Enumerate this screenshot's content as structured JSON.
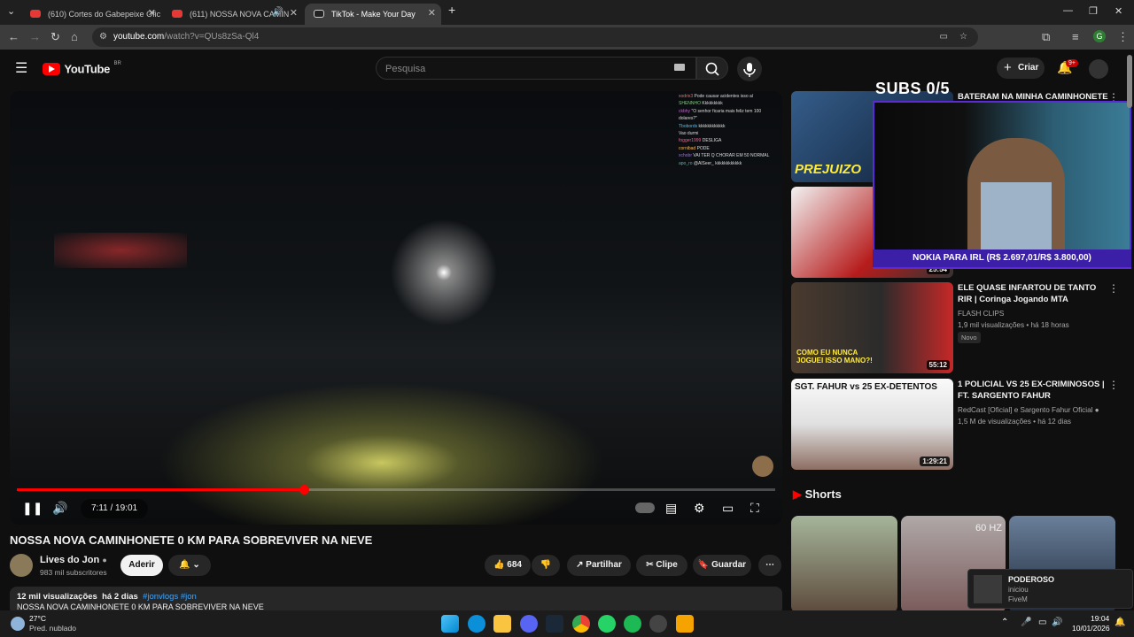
{
  "browser": {
    "tabs": [
      {
        "label": "(610) Cortes do Gabepeixe Ofic",
        "active": false
      },
      {
        "label": "(611) NOSSA NOVA CAMIN",
        "active": false
      },
      {
        "label": "TikTok - Make Your Day",
        "active": true
      }
    ],
    "url_host": "youtube.com",
    "url_path": "/watch?v=QUs8zSa-Ql4",
    "new_tab": "+",
    "profile_initial": "G"
  },
  "header": {
    "logo": "YouTube",
    "region": "BR",
    "search_placeholder": "Pesquisa",
    "create_label": "Criar",
    "notifications": "9+"
  },
  "video": {
    "current_time": "7:11",
    "duration": "19:01",
    "time_text": "7:11 / 19:01",
    "progress": 0.378,
    "chat": [
      {
        "user": "xodrix3",
        "text": "Pode causar acidentes isso aí"
      },
      {
        "user": "SHENNHO",
        "text": "Kkkkkkkkk"
      },
      {
        "user": "ckbhy",
        "text": "\"O senhor ficaria mais feliz tem 100 dolares?\""
      },
      {
        "user": "Tbobords",
        "text": "kkkkkkkkkkkk"
      },
      {
        "user": "",
        "text": "Vao durmi"
      },
      {
        "user": "fogger1999",
        "text": "DESLIGA"
      },
      {
        "user": "cornibad",
        "text": "PODE"
      },
      {
        "user": "xchobr",
        "text": "VAI TER Q CHORAR EM 50 NORMAL"
      },
      {
        "user": "apo_ro",
        "text": "@AlSeer_ kkkkkkkkkkkk"
      }
    ]
  },
  "meta": {
    "title": "NOSSA NOVA CAMINHONETE 0 KM PARA SOBREVIVER NA NEVE",
    "channel": "Lives do Jon",
    "subscribers": "983 mil subscritores",
    "join_label": "Aderir",
    "likes": "684",
    "share_label": "Partilhar",
    "clip_label": "Clipe",
    "save_label": "Guardar",
    "views": "12 mil visualizações",
    "age": "há 2 dias",
    "tags": "#jonvlogs #jon",
    "desc_preview": "NOSSA NOVA CAMINHONETE 0 KM PARA SOBREVIVER NA NEVE"
  },
  "overlay": {
    "subs_counter": "SUBS 0/5",
    "cam_caption": "NOKIA PARA IRL (R$ 2.697,01/R$ 3.800,00)"
  },
  "recommendations": [
    {
      "title": "BATERAM NA MINHA CAMINHONETE",
      "thumb_text": "PREJUIZO",
      "duration": "",
      "channel": "",
      "stats": ""
    },
    {
      "title": "",
      "thumb_text": "",
      "duration": "25:54",
      "channel": "",
      "stats": ""
    },
    {
      "title": "ELE QUASE INFARTOU DE TANTO RIR | Coringa Jogando MTA",
      "thumb_text": "COMO EU NUNCA JOGUEI ISSO MANO?!",
      "duration": "55:12",
      "channel": "FLASH CLIPS",
      "stats": "1,9 mil visualizações • há 18 horas",
      "badge": "Novo"
    },
    {
      "title": "1 POLICIAL VS 25 EX-CRIMINOSOS | FT. SARGENTO FAHUR",
      "thumb_text": "SGT. FAHUR vs 25 EX-DETENTOS",
      "duration": "1:29:21",
      "channel": "RedCast [Oficial] e Sargento Fahur Oficial",
      "stats": "1,5 M de visualizações • há 12 dias"
    }
  ],
  "shorts": {
    "heading": "Shorts",
    "items": [
      {
        "overlay": ""
      },
      {
        "overlay": "60 HZ"
      },
      {
        "overlay": ""
      }
    ]
  },
  "toast": {
    "title": "PODEROSO",
    "line1": "iniciou",
    "line2": "FiveM"
  },
  "taskbar": {
    "weather_temp": "27°C",
    "weather_desc": "Pred. nublado",
    "time": "19:04",
    "date": "10/01/2026"
  },
  "colors": {
    "accent": "#ff0000",
    "link": "#3ea6ff",
    "cam_border": "#5a2bd6"
  }
}
